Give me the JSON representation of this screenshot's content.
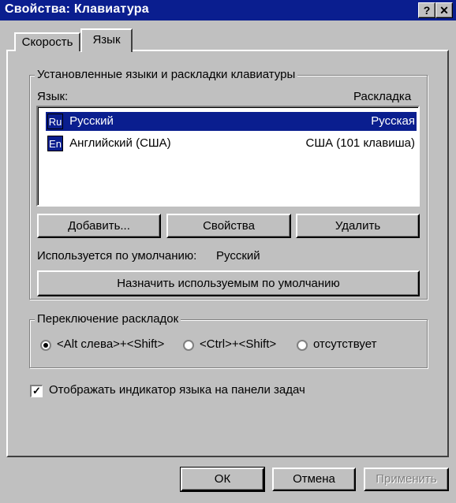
{
  "window": {
    "title": "Свойства: Клавиатура",
    "help_label": "?",
    "close_label": "✕"
  },
  "tabs": [
    {
      "label": "Скорость",
      "active": false
    },
    {
      "label": "Язык",
      "active": true
    }
  ],
  "installed_group": {
    "legend": "Установленные языки и раскладки клавиатуры",
    "col_language": "Язык:",
    "col_layout": "Раскладка",
    "rows": [
      {
        "code": "Ru",
        "language": "Русский",
        "layout": "Русская",
        "selected": true
      },
      {
        "code": "En",
        "language": "Английский (США)",
        "layout": "США (101 клавиша)",
        "selected": false
      }
    ],
    "add_label": "Добавить...",
    "properties_label": "Свойства",
    "delete_label": "Удалить",
    "default_label": "Используется по умолчанию:",
    "default_value": "Русский",
    "set_default_label": "Назначить используемым по умолчанию"
  },
  "switch_group": {
    "legend": "Переключение раскладок",
    "options": [
      {
        "label": "<Alt слева>+<Shift>",
        "checked": true
      },
      {
        "label": "<Ctrl>+<Shift>",
        "checked": false
      },
      {
        "label": "отсутствует",
        "checked": false
      }
    ]
  },
  "indicator": {
    "label": "Отображать индикатор языка на панели задач",
    "checked": true,
    "check_glyph": "✓"
  },
  "footer": {
    "ok_label": "ОК",
    "cancel_label": "Отмена",
    "apply_label": "Применить"
  }
}
